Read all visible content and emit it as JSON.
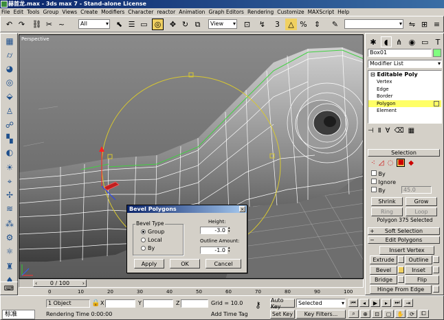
{
  "app": {
    "title": "赫首龙.max - 3ds max 7 - Stand-alone License"
  },
  "menu": [
    "File",
    "Edit",
    "Tools",
    "Group",
    "Views",
    "Create",
    "Modifiers",
    "Character",
    "reactor",
    "Animation",
    "Graph Editors",
    "Rendering",
    "Customize",
    "MAXScript",
    "Help"
  ],
  "toolbar": {
    "selection_filter": "All",
    "ref_coord": "View",
    "named_sel": ""
  },
  "viewport": {
    "label": "Perspective"
  },
  "right_panel": {
    "object_name": "Box01",
    "modifier_list": "Modifier List",
    "stack": {
      "root": "Editable Poly",
      "items": [
        "Vertex",
        "Edge",
        "Border",
        "Polygon",
        "Element"
      ],
      "selected": "Polygon"
    },
    "selection": {
      "title": "Selection",
      "by_vertex": "By",
      "ignore": "Ignore",
      "by_angle": "By",
      "angle": "45.0",
      "shrink": "Shrink",
      "grow": "Grow",
      "ring": "Ring",
      "loop": "Loop",
      "status": "Polygon 375 Selected"
    },
    "soft_selection": "Soft Selection",
    "edit_polygons": {
      "title": "Edit Polygons",
      "insert_vertex": "Insert Vertex",
      "extrude": "Extrude",
      "outline": "Outline",
      "bevel": "Bevel",
      "inset": "Inset",
      "bridge": "Bridge",
      "flip": "Flip",
      "hinge": "Hinge From Edge"
    }
  },
  "dialog": {
    "title": "Bevel Polygons",
    "group_label": "Bevel Type",
    "options": [
      "Group",
      "Local",
      "By"
    ],
    "selected": "Group",
    "height_label": "Height:",
    "height": "-3.0",
    "outline_label": "Outline Amount:",
    "outline": "-1.0",
    "apply": "Apply",
    "ok": "OK",
    "cancel": "Cancel"
  },
  "timeline": {
    "frame": "0 / 100",
    "ticks": [
      "0",
      "10",
      "20",
      "30",
      "40",
      "50",
      "60",
      "70",
      "80",
      "90",
      "100"
    ]
  },
  "status": {
    "objects": "1 Object",
    "x_label": "X",
    "y_label": "Y",
    "z_label": "Z",
    "grid": "Grid = 10.0",
    "auto_key": "Auto Key",
    "set_key": "Set Key",
    "key_filters": "Key Filters...",
    "selected": "Selected",
    "rendering_time": "Rendering Time  0:00:00",
    "add_time_tag": "Add Time Tag",
    "ime": "标准"
  },
  "colors": {
    "title_bg": "#0a246a",
    "wire": "#ffffff",
    "gizmo": "#d8c830",
    "selection": "#ff3030",
    "highlight": "#ffff66"
  }
}
